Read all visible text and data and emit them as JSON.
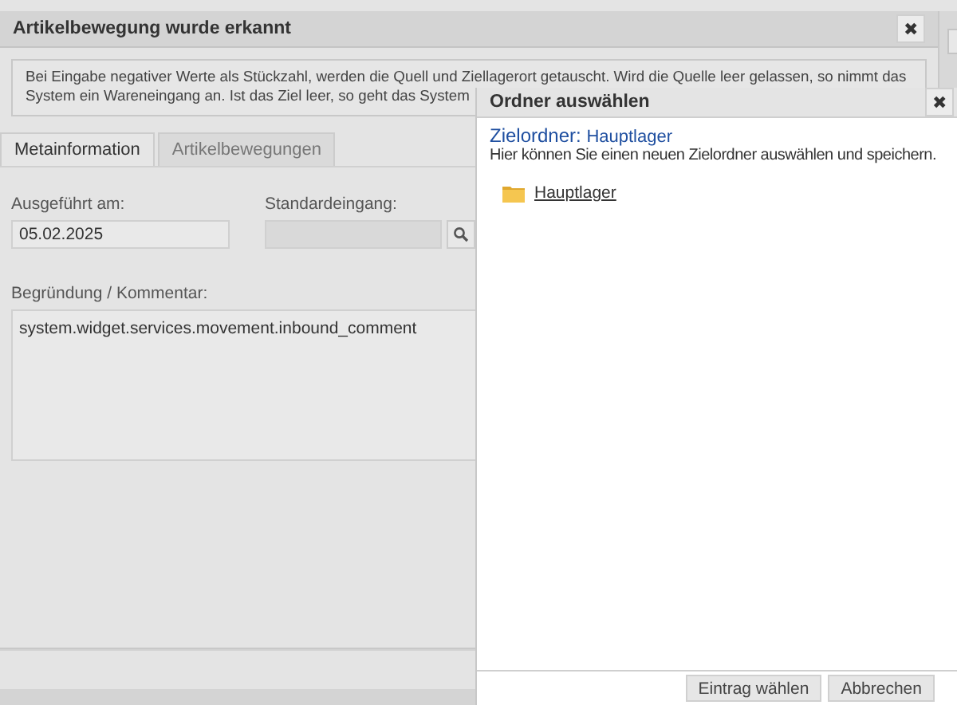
{
  "main_dialog": {
    "title": "Artikelbewegung wurde erkannt",
    "close": "✖",
    "info_lines": [
      "Bei Eingabe negativer Werte als Stückzahl, werden die Quell und Ziellagerort getauscht. Wird die Quelle leer gelassen, so nimmt das",
      "System ein Wareneingang an. Ist das Ziel leer, so geht das System"
    ],
    "tabs": [
      {
        "label": "Metainformation",
        "selected": true
      },
      {
        "label": "Artikelbewegungen",
        "selected": false
      }
    ],
    "executed": {
      "label": "Ausgeführt am:",
      "value": "05.02.2025"
    },
    "default_inbound": {
      "label": "Standardeingang:",
      "disabled": true
    },
    "comment": {
      "label": "Begründung / Kommentar:",
      "value": "system.widget.services.movement.inbound_comment"
    }
  },
  "folder_dialog": {
    "title": "Ordner auswählen",
    "close": "✖",
    "target_label": "Zielordner:",
    "target_value": "Hauptlager",
    "hint": "Hier können Sie einen neuen Zielordner auswählen und speichern.",
    "folders": [
      {
        "name": "Hauptlager"
      }
    ],
    "buttons": [
      "Eintrag wählen",
      "Abbrechen"
    ]
  }
}
